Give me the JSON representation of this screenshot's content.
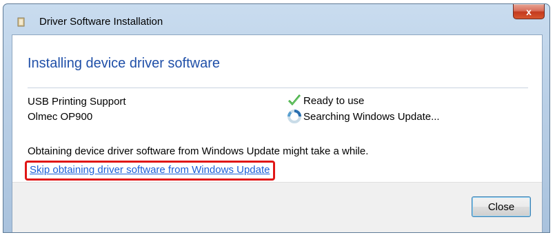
{
  "window": {
    "title": "Driver Software Installation",
    "close_glyph": "x"
  },
  "content": {
    "heading": "Installing device driver software",
    "devices": [
      {
        "name": "USB Printing Support",
        "status": "Ready to use",
        "status_icon": "checkmark-icon"
      },
      {
        "name": "Olmec OP900",
        "status": "Searching Windows Update...",
        "status_icon": "busy-spinner-icon"
      }
    ],
    "info_text": "Obtaining device driver software from Windows Update might take a while.",
    "skip_link": "Skip obtaining driver software from Windows Update"
  },
  "footer": {
    "close_label": "Close"
  },
  "colors": {
    "heading": "#1f4fa8",
    "link": "#1a5fd8",
    "highlight": "#e01616",
    "check": "#3aa83a"
  }
}
